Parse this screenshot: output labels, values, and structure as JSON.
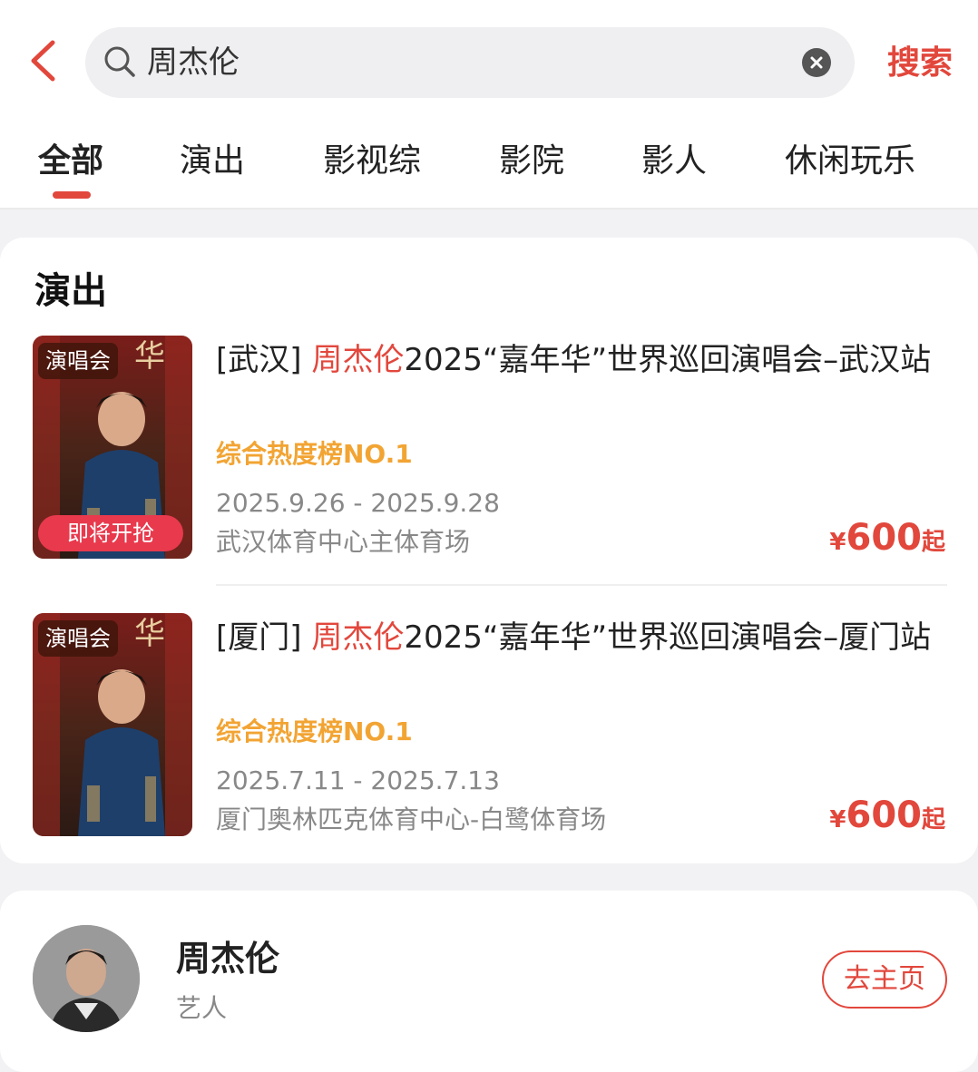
{
  "search": {
    "query": "周杰伦",
    "submit_label": "搜索"
  },
  "tabs": [
    {
      "label": "全部",
      "active": true
    },
    {
      "label": "演出"
    },
    {
      "label": "影视综"
    },
    {
      "label": "影院"
    },
    {
      "label": "影人"
    },
    {
      "label": "休闲玩乐"
    }
  ],
  "section": {
    "title": "演出"
  },
  "events": [
    {
      "city_tag": "[武汉]",
      "artist": "周杰伦",
      "title_rest": "2025“嘉年华”世界巡回演唱会–武汉站",
      "rank": "综合热度榜NO.1",
      "dates": "2025.9.26 - 2025.9.28",
      "venue": "武汉体育中心主体育场",
      "price_symbol": "¥",
      "price": "600",
      "price_suffix": "起",
      "poster_badge": "演唱会",
      "poster_button": "即将开抢"
    },
    {
      "city_tag": "[厦门]",
      "artist": "周杰伦",
      "title_rest": "2025“嘉年华”世界巡回演唱会–厦门站",
      "rank": "综合热度榜NO.1",
      "dates": "2025.7.11 - 2025.7.13",
      "venue": "厦门奥林匹克体育中心-白鹭体育场",
      "price_symbol": "¥",
      "price": "600",
      "price_suffix": "起",
      "poster_badge": "演唱会"
    }
  ],
  "artist_card": {
    "name": "周杰伦",
    "role": "艺人",
    "button_label": "去主页"
  },
  "colors": {
    "accent": "#e2473c",
    "rank": "#f2a433",
    "muted": "#888888",
    "background": "#f2f2f4"
  }
}
